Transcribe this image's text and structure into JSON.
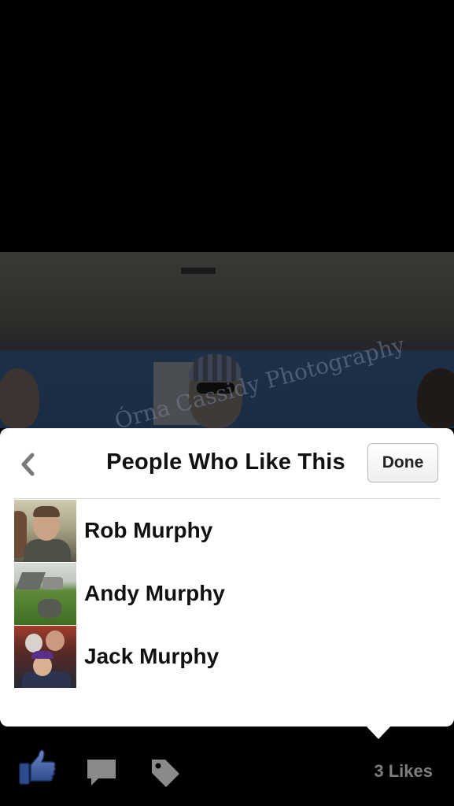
{
  "photo": {
    "watermark": "Órna Cassidy Photography"
  },
  "likes_sheet": {
    "title": "People Who Like This",
    "done_label": "Done",
    "people": [
      {
        "name": "Rob Murphy"
      },
      {
        "name": "Andy Murphy"
      },
      {
        "name": "Jack Murphy"
      }
    ]
  },
  "toolbar": {
    "likes_count": "3 Likes",
    "icons": [
      "thumbs-up-icon",
      "comment-icon",
      "tag-icon"
    ],
    "accent_color": "#3b5998"
  }
}
